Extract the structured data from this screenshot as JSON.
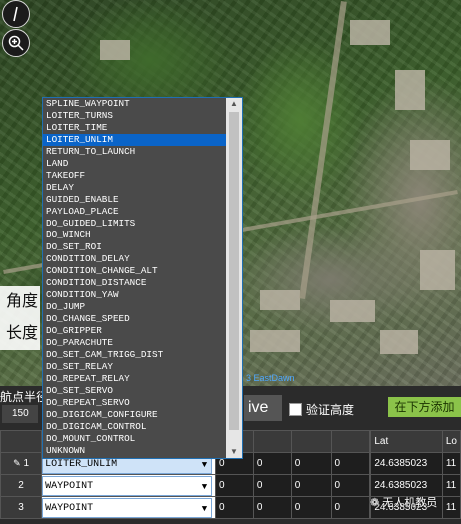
{
  "map": {
    "attribution": "3 EastDawn"
  },
  "side_labels": {
    "angle": "角度",
    "length": "长度"
  },
  "panel": {
    "waypoint_radius_label": "航点半径",
    "waypoint_radius_value": "150",
    "mode_value": "ive",
    "verify_height_label": "验证高度",
    "add_below_button": "在下方添加"
  },
  "grid": {
    "headers": [
      "",
      "",
      "",
      "",
      "",
      "",
      "",
      "Lat",
      "Lo"
    ],
    "rows": [
      {
        "num": "1",
        "command": "LOITER_UNLIM",
        "p1": "0",
        "p2": "0",
        "p3": "0",
        "p4": "0",
        "lat": "24.6385023",
        "lon": "11"
      },
      {
        "num": "2",
        "command": "WAYPOINT",
        "p1": "0",
        "p2": "0",
        "p3": "0",
        "p4": "0",
        "lat": "24.6385023",
        "lon": "11"
      },
      {
        "num": "3",
        "command": "WAYPOINT",
        "p1": "0",
        "p2": "0",
        "p3": "0",
        "p4": "0",
        "lat": "24.6385023",
        "lon": "11"
      }
    ]
  },
  "dropdown": {
    "selected": "LOITER_UNLIM",
    "items": [
      "SPLINE_WAYPOINT",
      "LOITER_TURNS",
      "LOITER_TIME",
      "LOITER_UNLIM",
      "RETURN_TO_LAUNCH",
      "LAND",
      "TAKEOFF",
      "DELAY",
      "GUIDED_ENABLE",
      "PAYLOAD_PLACE",
      "DO_GUIDED_LIMITS",
      "DO_WINCH",
      "DO_SET_ROI",
      "CONDITION_DELAY",
      "CONDITION_CHANGE_ALT",
      "CONDITION_DISTANCE",
      "CONDITION_YAW",
      "DO_JUMP",
      "DO_CHANGE_SPEED",
      "DO_GRIPPER",
      "DO_PARACHUTE",
      "DO_SET_CAM_TRIGG_DIST",
      "DO_SET_RELAY",
      "DO_REPEAT_RELAY",
      "DO_SET_SERVO",
      "DO_REPEAT_SERVO",
      "DO_DIGICAM_CONFIGURE",
      "DO_DIGICAM_CONTROL",
      "DO_MOUNT_CONTROL",
      "UNKNOWN"
    ]
  },
  "watermark": "无人机教员"
}
